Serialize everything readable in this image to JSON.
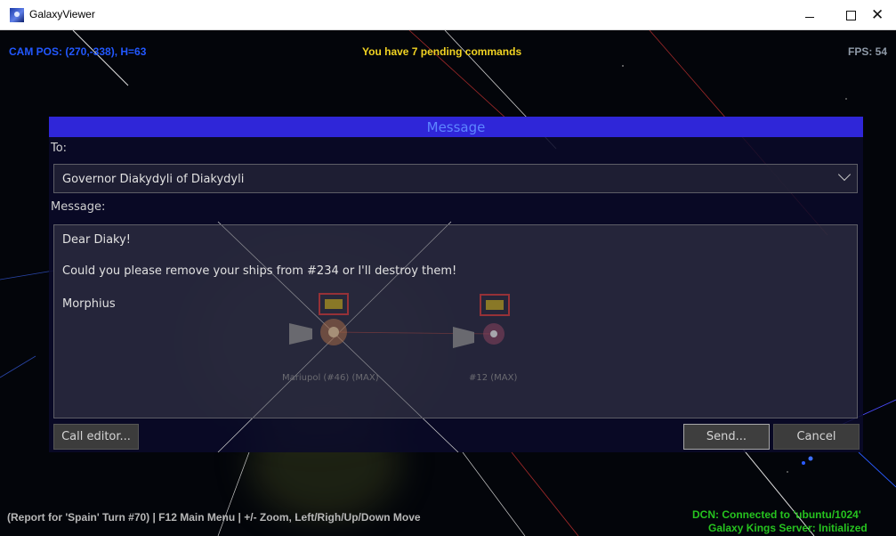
{
  "window": {
    "title": "GalaxyViewer",
    "minimize": "–",
    "maximize": "□",
    "close": "✕",
    "app_icon": "galaxy-app-icon"
  },
  "hud": {
    "cam_pos": "CAM POS: (270,-338), H=63",
    "pending": "You have 7 pending commands",
    "fps": "FPS: 54",
    "report": "(Report for 'Spain' Turn #70) | F12 Main Menu | +/- Zoom, Left/Righ/Up/Down Move",
    "dcn": "DCN: Connected to 'ubuntu/1024'",
    "server": "Galaxy Kings Server: Initialized"
  },
  "dialog": {
    "title": "Message",
    "to_label": "To:",
    "recipient": "Governor Diakydyli of Diakydyli",
    "message_label": "Message:",
    "message_lines": [
      "Dear Diaky!",
      "Could you please remove your ships from #234 or I'll destroy them!",
      "Morphius"
    ],
    "buttons": {
      "editor": "Call editor...",
      "send": "Send...",
      "cancel": "Cancel"
    }
  },
  "map": {
    "ships": [
      {
        "label": "Mariupol (#46) (MAX)"
      },
      {
        "label": "#12 (MAX)"
      }
    ]
  },
  "colors": {
    "header": "#2f26d8",
    "title_text": "#5d86ff",
    "cam_pos": "#2258ff",
    "pending": "#f1d322",
    "status_green": "#26c31f"
  }
}
